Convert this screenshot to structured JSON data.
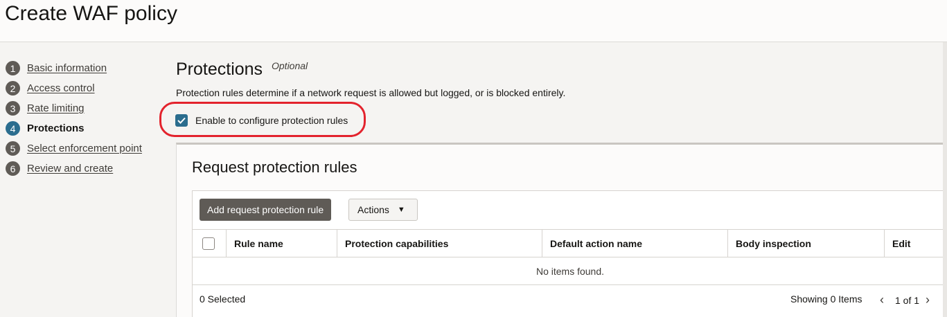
{
  "page": {
    "title": "Create WAF policy"
  },
  "steps": [
    {
      "num": "1",
      "label": "Basic information"
    },
    {
      "num": "2",
      "label": "Access control"
    },
    {
      "num": "3",
      "label": "Rate limiting"
    },
    {
      "num": "4",
      "label": "Protections",
      "active": true
    },
    {
      "num": "5",
      "label": "Select enforcement point"
    },
    {
      "num": "6",
      "label": "Review and create"
    }
  ],
  "section": {
    "title": "Protections",
    "optional": "Optional",
    "description": "Protection rules determine if a network request is allowed but logged, or is blocked entirely.",
    "enable_label": "Enable to configure protection rules",
    "enable_checked": true
  },
  "card": {
    "title": "Request protection rules",
    "add_button": "Add request protection rule",
    "actions_button": "Actions",
    "columns": [
      "Rule name",
      "Protection capabilities",
      "Default action name",
      "Body inspection",
      "Edit"
    ],
    "empty_text": "No items found.",
    "selected": "0 Selected",
    "showing": "Showing 0 Items",
    "pager": "1 of 1"
  },
  "colors": {
    "accent": "#2b6d8e",
    "highlight": "#e3232d",
    "primary_button": "#5f5b56"
  }
}
